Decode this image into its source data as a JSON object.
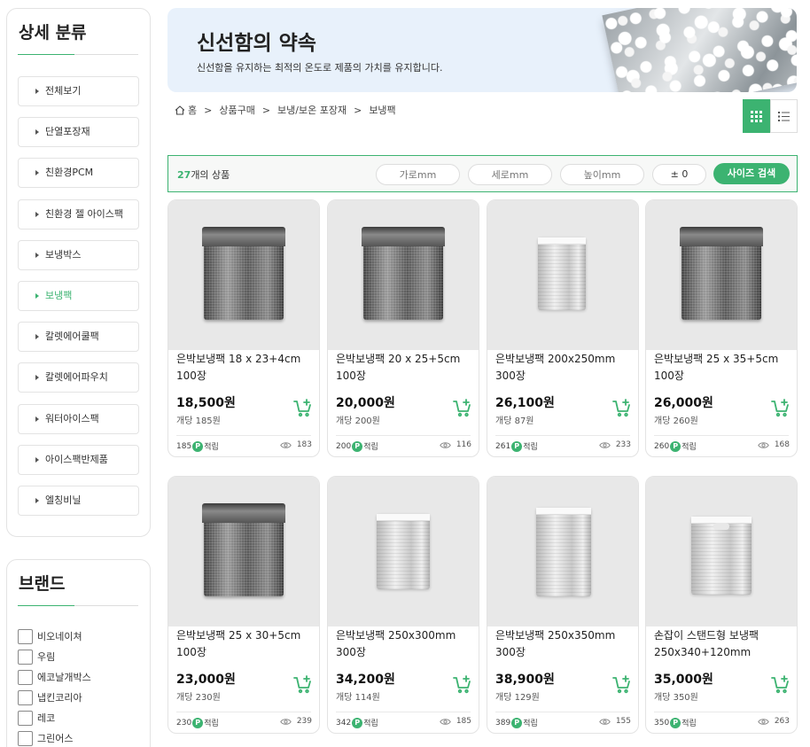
{
  "sidebar": {
    "category_title": "상세 분류",
    "categories": [
      "전체보기",
      "단열포장재",
      "친환경PCM",
      "친환경 젤 아이스팩",
      "보냉박스",
      "보냉팩",
      "칼렛에어쿨팩",
      "칼렛에어파우치",
      "워터아이스팩",
      "아이스팩반제품",
      "엘칭비닐"
    ],
    "active_category": "보냉팩",
    "brand_title": "브랜드",
    "brands": [
      "비오네이쳐",
      "우림",
      "에코날개박스",
      "냅킨코리아",
      "레코",
      "그린어스"
    ]
  },
  "banner": {
    "title": "신선함의 약속",
    "subtitle": "신선함을 유지하는 최적의 온도로 제품의 가치를 유지합니다."
  },
  "breadcrumb": [
    "홈",
    "상품구매",
    "보냉/보온 포장재",
    "보냉팩"
  ],
  "breadcrumb_separator": ">",
  "filter": {
    "count": "27",
    "count_suffix": "개의 상품",
    "width_placeholder": "가로mm",
    "length_placeholder": "세로mm",
    "height_placeholder": "높이mm",
    "tolerance": "± 0",
    "search_button": "사이즈 검색"
  },
  "products": [
    {
      "name": "은박보냉팩 18 x 23+4cm 100장",
      "price": "18,500원",
      "unit_price": "개당 185원",
      "points": "185",
      "points_label": "적립",
      "views": "183",
      "image": "dark"
    },
    {
      "name": "은박보냉팩 20 x 25+5cm 100장",
      "price": "20,000원",
      "unit_price": "개당 200원",
      "points": "200",
      "points_label": "적립",
      "views": "116",
      "image": "dark"
    },
    {
      "name": "은박보냉팩 200x250mm 300장",
      "price": "26,100원",
      "unit_price": "개당 87원",
      "points": "261",
      "points_label": "적립",
      "views": "233",
      "image": "light-small"
    },
    {
      "name": "은박보냉팩 25 x 35+5cm 100장",
      "price": "26,000원",
      "unit_price": "개당 260원",
      "points": "260",
      "points_label": "적립",
      "views": "168",
      "image": "dark"
    },
    {
      "name": "은박보냉팩 25 x 30+5cm 100장",
      "price": "23,000원",
      "unit_price": "개당 230원",
      "points": "230",
      "points_label": "적립",
      "views": "239",
      "image": "dark"
    },
    {
      "name": "은박보냉팩 250x300mm 300장",
      "price": "34,200원",
      "unit_price": "개당 114원",
      "points": "342",
      "points_label": "적립",
      "views": "185",
      "image": "light"
    },
    {
      "name": "은박보냉팩 250x350mm 300장",
      "price": "38,900원",
      "unit_price": "개당 129원",
      "points": "389",
      "points_label": "적립",
      "views": "155",
      "image": "light-tall"
    },
    {
      "name": "손잡이 스탠드형 보냉팩 250x340+120mm",
      "price": "35,000원",
      "unit_price": "개당 350원",
      "points": "350",
      "points_label": "적립",
      "views": "263",
      "image": "stand"
    }
  ],
  "points_badge": "P",
  "colors": {
    "accent": "#3cb371",
    "banner_bg": "#e8f1fb"
  },
  "icons": {
    "home": "home-icon",
    "grid": "grid-view-icon",
    "list": "list-view-icon",
    "cart": "cart-plus-icon",
    "views": "eye-icon"
  }
}
